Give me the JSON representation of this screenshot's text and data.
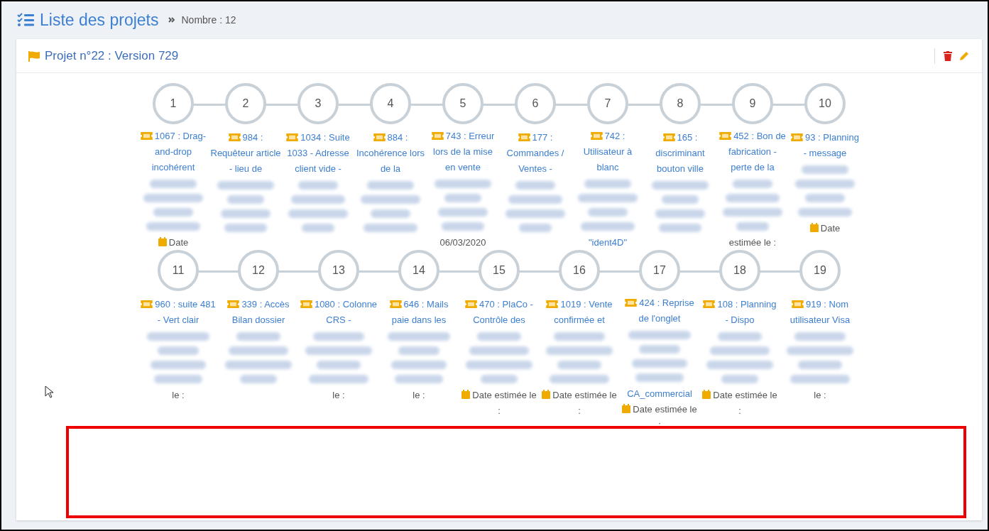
{
  "page": {
    "title": "Liste des projets",
    "count": "Nombre : 12"
  },
  "project": {
    "title": "Projet n°22 : Version 729"
  },
  "rows": [
    {
      "steps": [
        {
          "number": "1",
          "ticket": "1067 : Drag-and-drop incohérent",
          "tail": [
            {
              "kind": "date",
              "text": "Date"
            }
          ]
        },
        {
          "number": "2",
          "ticket": "984 : Requêteur article - lieu de"
        },
        {
          "number": "3",
          "ticket": "1034 : Suite 1033 - Adresse client vide -"
        },
        {
          "number": "4",
          "ticket": "884 : Incohérence lors de la"
        },
        {
          "number": "5",
          "ticket": "743 : Erreur lors de la mise en vente",
          "tail": [
            {
              "kind": "text",
              "text": "06/03/2020"
            }
          ]
        },
        {
          "number": "6",
          "ticket": "177 : Commandes / Ventes -"
        },
        {
          "number": "7",
          "ticket": "742 : Utilisateur à blanc",
          "tail": [
            {
              "kind": "link",
              "text": "\"ident4D\""
            }
          ]
        },
        {
          "number": "8",
          "ticket": "165 : discriminant bouton ville"
        },
        {
          "number": "9",
          "ticket": "452 : Bon de fabrication - perte de la",
          "tail": [
            {
              "kind": "text",
              "text": "estimée le :"
            }
          ]
        },
        {
          "number": "10",
          "ticket": "93 : Planning - message",
          "tail": [
            {
              "kind": "date",
              "text": "Date"
            }
          ]
        }
      ]
    },
    {
      "steps": [
        {
          "number": "11",
          "ticket": "960 : suite 481 - Vert clair",
          "tail": [
            {
              "kind": "text",
              "text": "le :"
            }
          ]
        },
        {
          "number": "12",
          "ticket": "339 : Accès Bilan dossier"
        },
        {
          "number": "13",
          "ticket": "1080 : Colonne CRS -",
          "tail": [
            {
              "kind": "text",
              "text": "le :"
            }
          ]
        },
        {
          "number": "14",
          "ticket": "646 : Mails paie dans les",
          "tail": [
            {
              "kind": "text",
              "text": "le :"
            }
          ]
        },
        {
          "number": "15",
          "ticket": "470 : PlaCo - Contrôle des",
          "tail": [
            {
              "kind": "date",
              "text": "Date estimée le :"
            }
          ]
        },
        {
          "number": "16",
          "ticket": "1019 : Vente confirmée et",
          "tail": [
            {
              "kind": "date",
              "text": "Date estimée le :"
            }
          ]
        },
        {
          "number": "17",
          "ticket": "424 : Reprise de l'onglet",
          "tail": [
            {
              "kind": "link",
              "text": "CA_commercial"
            },
            {
              "kind": "date",
              "text": "Date estimée le :"
            }
          ]
        },
        {
          "number": "18",
          "ticket": "108 : Planning - Dispo",
          "tail": [
            {
              "kind": "date",
              "text": "Date estimée le :"
            }
          ]
        },
        {
          "number": "19",
          "ticket": "919 : Nom utilisateur Visa",
          "tail": [
            {
              "kind": "text",
              "text": "le :"
            }
          ]
        }
      ]
    }
  ]
}
